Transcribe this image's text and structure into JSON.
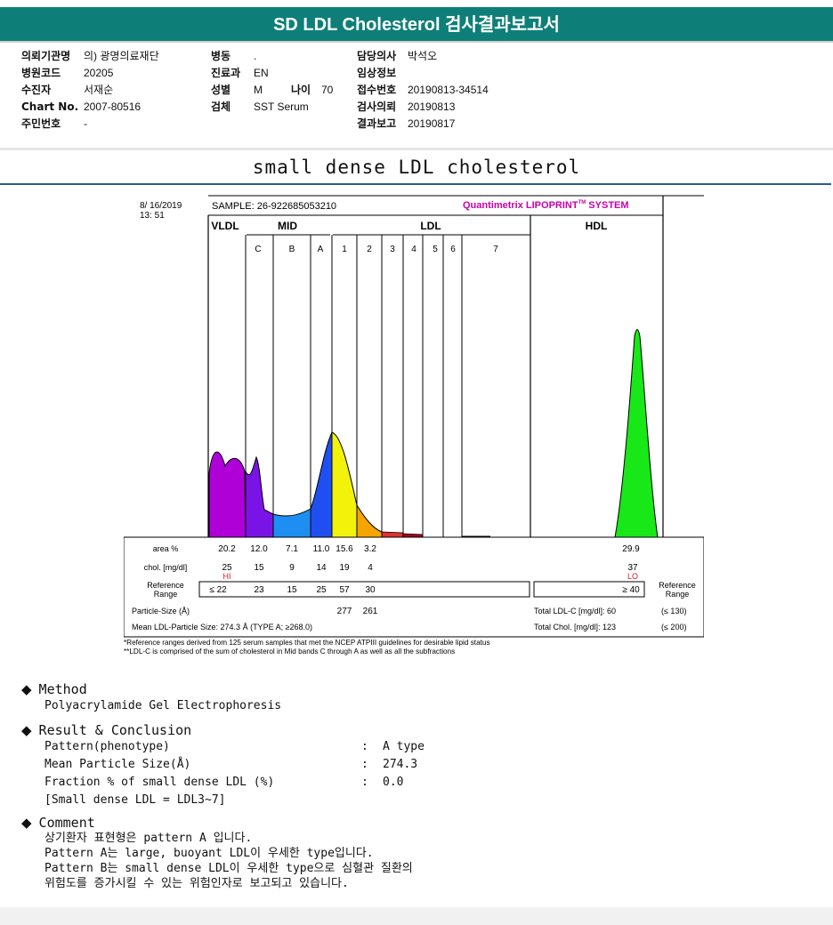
{
  "header": {
    "title": "SD LDL Cholesterol 검사결과보고서"
  },
  "info": {
    "col1": [
      {
        "label": "의뢰기관명",
        "value": "의) 광명의료재단"
      },
      {
        "label": "병원코드",
        "value": "20205"
      },
      {
        "label": "수진자",
        "value": "서재순"
      },
      {
        "label": "Chart No.",
        "value": "2007-80516"
      },
      {
        "label": "주민번호",
        "value": "-"
      }
    ],
    "col2": [
      {
        "label": "병동",
        "value": "."
      },
      {
        "label": "진료과",
        "value": "EN"
      },
      {
        "label": "성별",
        "value": "M"
      },
      {
        "label": "검체",
        "value": "SST Serum"
      }
    ],
    "age": {
      "label": "나이",
      "value": "70"
    },
    "col3": [
      {
        "label": "담당의사",
        "value": "박석오"
      },
      {
        "label": "임상정보",
        "value": ""
      },
      {
        "label": "접수번호",
        "value": "20190813-34514"
      },
      {
        "label": "검사의뢰",
        "value": "20190813"
      },
      {
        "label": "결과보고",
        "value": "20190817"
      }
    ]
  },
  "subtitle": "small dense LDL cholesterol",
  "report": {
    "date": "8/ 16/2019",
    "time": "13: 51",
    "sample": "SAMPLE:   26-922685053210",
    "brand": "Quantimetrix LIPOPRINT",
    "brand_tm": "TM",
    "brand_suffix": " SYSTEM",
    "groups": {
      "vldl": "VLDL",
      "mid": "MID",
      "ldl": "LDL",
      "hdl": "HDL"
    },
    "bands": [
      "C",
      "B",
      "A",
      "1",
      "2",
      "3",
      "4",
      "5",
      "6",
      "7"
    ],
    "area_label": "area %",
    "area_values": [
      "20.2",
      "12.0",
      "7.1",
      "11.0",
      "15.6",
      "3.2"
    ],
    "hdl_area": "29.9",
    "chol_label": "chol. [mg/dl]",
    "chol_values": [
      "25",
      "15",
      "9",
      "14",
      "19",
      "4"
    ],
    "hdl_chol": "37",
    "hi_flag": "HI",
    "lo_flag": "LO",
    "ref_label_1": "Reference",
    "ref_label_2": "Range",
    "ref_values": [
      "≤  22",
      "23",
      "15",
      "25",
      "57",
      "30"
    ],
    "hdl_ref": "≥ 40",
    "particle_label": "Particle-Size (Å)",
    "particle_values": [
      "277",
      "261"
    ],
    "total_ldl_label": "Total LDL-C [mg/dl]:  60",
    "total_ldl_ref": "(≤ 130)",
    "mean_label": "Mean LDL-Particle Size:   274.3 Å   (TYPE A; ≥268.0)",
    "total_chol_label": "Total Chol. [mg/dl]:    123",
    "total_chol_ref": "(≤ 200)",
    "note1": "*Reference ranges derived from 125 serum samples that met the NCEP ATPIII guidelines for desirable lipid status",
    "note2": "**LDL-C is comprised of the sum of cholesterol in Mid bands C through A as well as all the subfractions",
    "colors": {
      "vldl": "#b000d8",
      "midC": "#7a14e6",
      "midB": "#1e8ef2",
      "midA": "#1f4ff0",
      "ldl1": "#f2f20a",
      "ldl2": "#f5a400",
      "ldl3": "#e03030",
      "ldl4": "#a80020",
      "hdl": "#18e818",
      "brand": "#cc00aa",
      "hi": "#d02020"
    }
  },
  "method": {
    "title": "Method",
    "text": "Polyacrylamide Gel Electrophoresis"
  },
  "result": {
    "title": "Result & Conclusion",
    "rows": [
      {
        "label": "Pattern(phenotype)",
        "colon": ":",
        "value": "A type"
      },
      {
        "label": "Mean Particle Size(Å)",
        "colon": ":",
        "value": "274.3"
      },
      {
        "label": "Fraction % of small dense LDL (%)",
        "colon": ":",
        "value": "0.0"
      }
    ],
    "note": "[Small dense LDL = LDL3~7]"
  },
  "comment": {
    "title": "Comment",
    "lines": [
      "상기환자 표현형은 pattern A 입니다.",
      "Pattern A는 large, buoyant LDL이 우세한 type입니다.",
      "Pattern B는 small dense LDL이 우세한 type으로 심혈관 질환의",
      "위험도를 증가시킬 수 있는 위험인자로 보고되고 있습니다."
    ]
  }
}
